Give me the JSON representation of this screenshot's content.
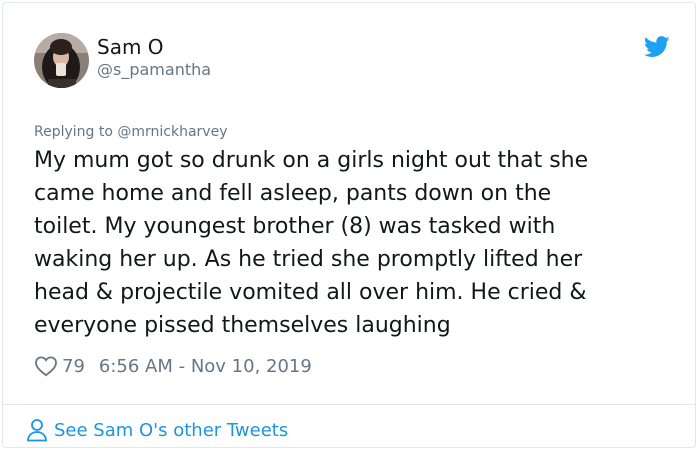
{
  "tweet": {
    "author_name": "Sam O",
    "author_handle": "@s_pamantha",
    "reply_context": "Replying to @mrnickharvey",
    "body": "My mum got so drunk on a girls night out that she\ncame home and fell asleep, pants down on the\ntoilet. My youngest brother (8) was tasked with\nwaking her up. As he tried she promptly lifted her\nhead & projectile vomited all over him. He cried &\neveryone pissed themselves laughing",
    "like_count": "79",
    "timestamp": "6:56 AM - Nov 10, 2019"
  },
  "footer": {
    "more_tweets_label": "See Sam O's other Tweets"
  },
  "icons": {
    "brand": "twitter-bird-icon",
    "like": "heart-icon",
    "profile": "person-icon"
  },
  "colors": {
    "brand_blue": "#1da1f2",
    "link_blue": "#1b95e0",
    "secondary_text": "#657786",
    "primary_text": "#14171a",
    "border": "#e1e8ed"
  }
}
